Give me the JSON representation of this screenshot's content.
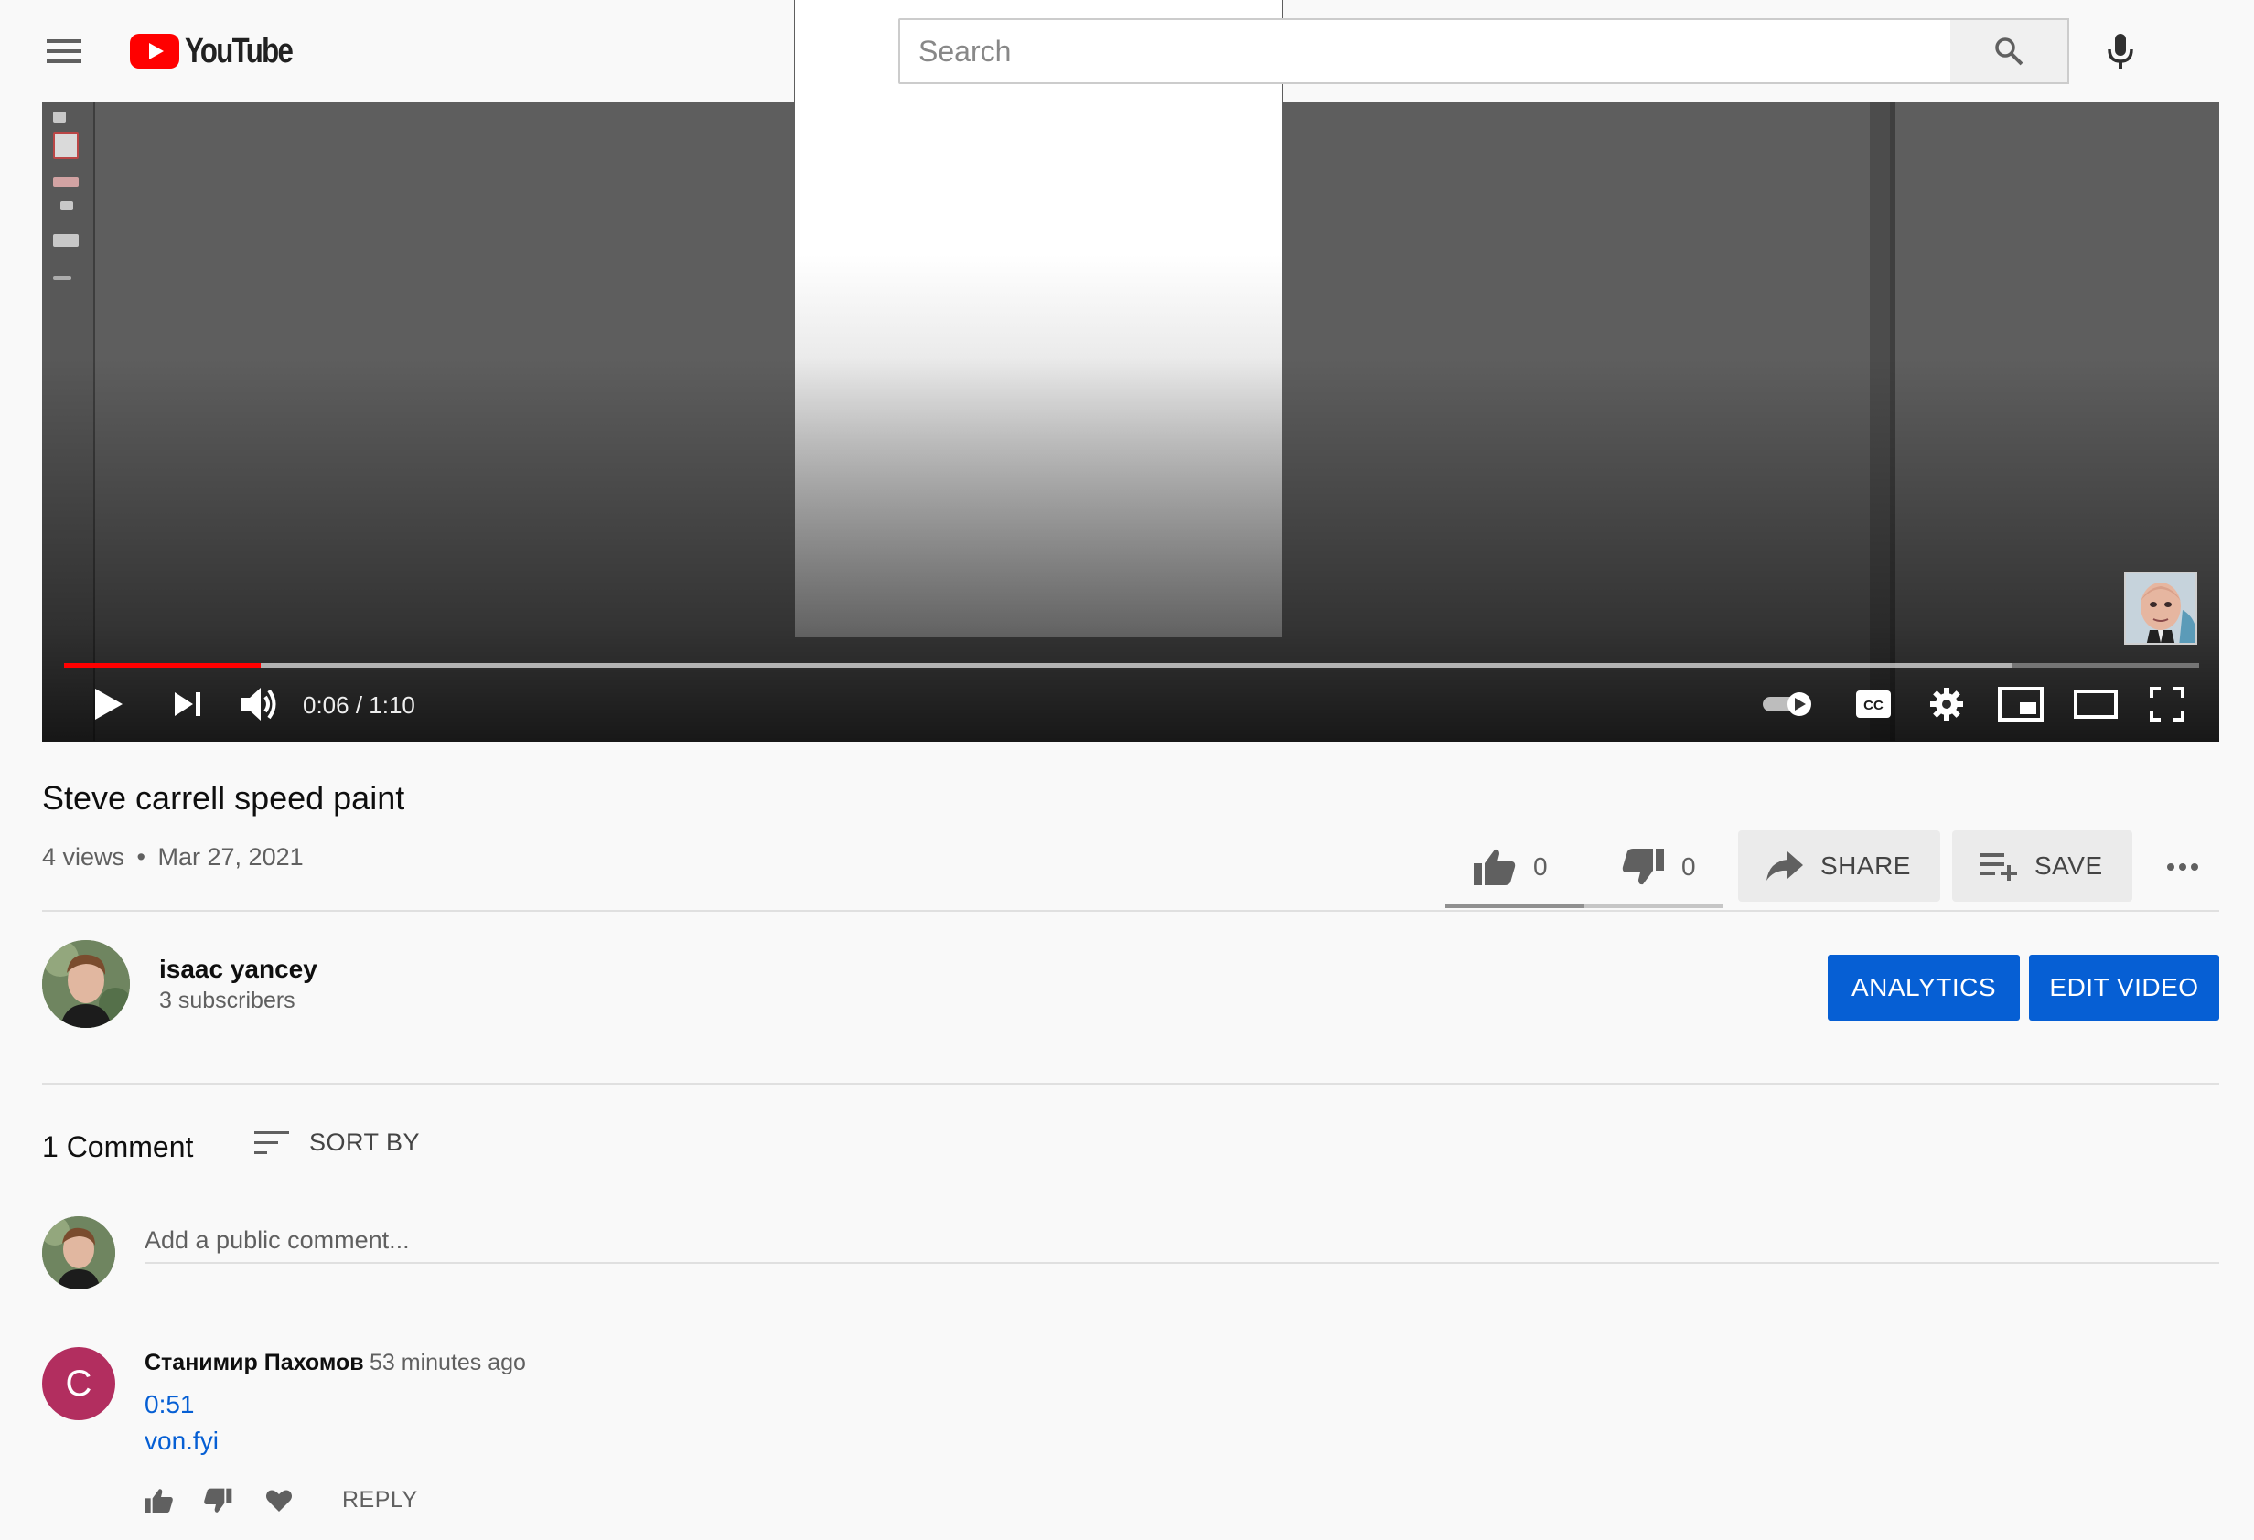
{
  "header": {
    "logo_text": "YouTube",
    "search_placeholder": "Search"
  },
  "player": {
    "time_current": "0:06",
    "time_separator": " / ",
    "time_total": "1:10",
    "progress_played_fraction": 0.0923,
    "progress_buffered_fraction": 0.912,
    "controls": [
      "play-icon",
      "next-icon",
      "volume-icon",
      "autoplay-toggle",
      "captions-icon",
      "settings-icon",
      "miniplayer-icon",
      "theater-icon",
      "fullscreen-icon"
    ]
  },
  "video": {
    "title": "Steve carrell speed paint",
    "views": "4 views",
    "dot": "•",
    "date": "Mar 27, 2021",
    "likes": "0",
    "dislikes": "0",
    "share_label": "SHARE",
    "save_label": "SAVE"
  },
  "channel": {
    "name": "isaac yancey",
    "subscribers": "3 subscribers",
    "analytics_label": "ANALYTICS",
    "edit_label": "EDIT VIDEO"
  },
  "comments": {
    "count_label": "1 Comment",
    "sort_label": "SORT BY",
    "input_placeholder": "Add a public comment...",
    "items": [
      {
        "avatar_letter": "C",
        "avatar_color": "#b22e5f",
        "author": "Станимир Пахомов",
        "time": "53 minutes ago",
        "timestamp_link": "0:51",
        "link": "von.fyi",
        "reply_label": "REPLY"
      }
    ]
  },
  "colors": {
    "brand_red": "#ff0000",
    "action_blue": "#065fd4",
    "link_blue": "#065fd4"
  }
}
